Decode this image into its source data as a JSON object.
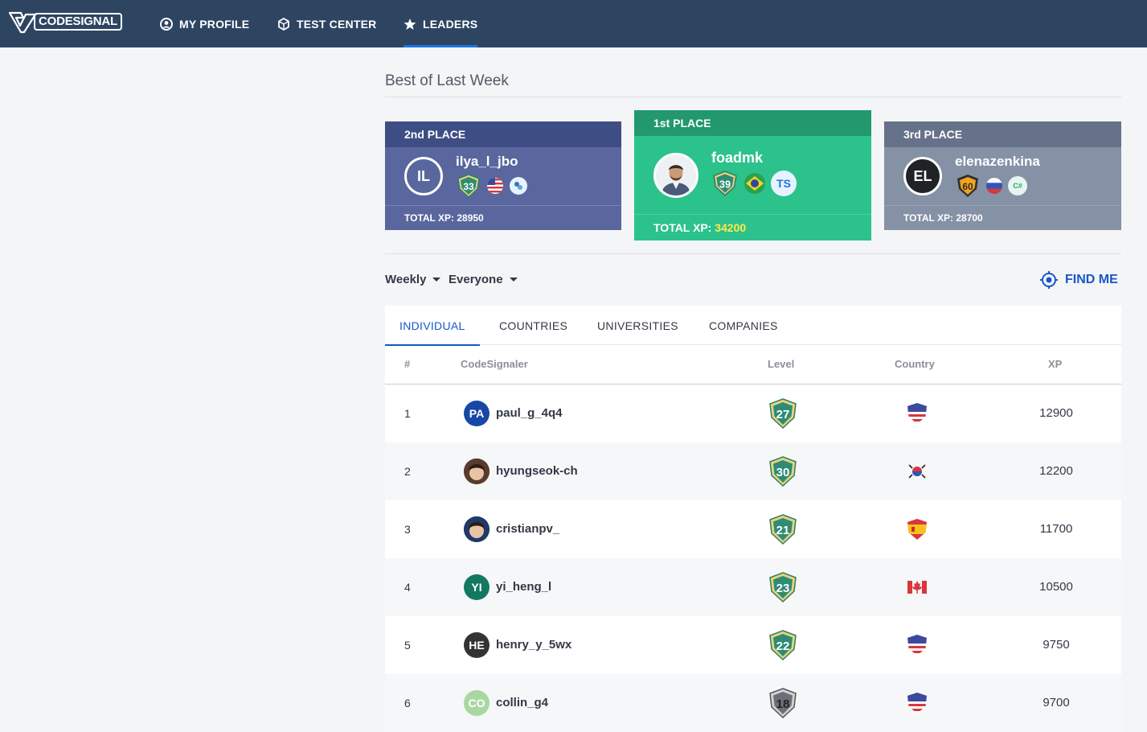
{
  "nav": {
    "logo_text": "CODESIGNAL",
    "items": [
      {
        "label": "MY PROFILE",
        "icon": "user-circle-icon"
      },
      {
        "label": "TEST CENTER",
        "icon": "cube-icon"
      },
      {
        "label": "LEADERS",
        "icon": "star-icon",
        "active": true
      }
    ]
  },
  "section_title": "Best of Last Week",
  "podium": {
    "second": {
      "place": "2nd PLACE",
      "initials": "IL",
      "username": "ilya_l_jbo",
      "level": "33",
      "xp_label": "TOTAL XP:",
      "xp": "28950"
    },
    "first": {
      "place": "1st PLACE",
      "username": "foadmk",
      "level": "39",
      "lang": "TS",
      "xp_label": "TOTAL XP:",
      "xp": "34200"
    },
    "third": {
      "place": "3rd PLACE",
      "initials": "EL",
      "username": "elenazenkina",
      "level": "60",
      "lang": "C#",
      "xp_label": "TOTAL XP:",
      "xp": "28700"
    }
  },
  "filters": {
    "period": "Weekly",
    "scope": "Everyone",
    "find_me": "FIND ME"
  },
  "tabs": [
    "INDIVIDUAL",
    "COUNTRIES",
    "UNIVERSITIES",
    "COMPANIES"
  ],
  "table": {
    "headers": {
      "rank": "#",
      "user": "CodeSignaler",
      "level": "Level",
      "country": "Country",
      "xp": "XP"
    },
    "rows": [
      {
        "rank": "1",
        "initials": "PA",
        "username": "paul_g_4q4",
        "level": "27",
        "country": "us",
        "xp": "12900",
        "avatar_color": "#1748a6"
      },
      {
        "rank": "2",
        "initials": "",
        "username": "hyungseok-ch",
        "level": "30",
        "country": "kr",
        "xp": "12200",
        "avatar_color": "#5a3b2e"
      },
      {
        "rank": "3",
        "initials": "",
        "username": "cristianpv_",
        "level": "21",
        "country": "es",
        "xp": "11700",
        "avatar_color": "#1f3a66"
      },
      {
        "rank": "4",
        "initials": "YI",
        "username": "yi_heng_l",
        "level": "23",
        "country": "ca",
        "xp": "10500",
        "avatar_color": "#137862"
      },
      {
        "rank": "5",
        "initials": "HE",
        "username": "henry_y_5wx",
        "level": "22",
        "country": "us",
        "xp": "9750",
        "avatar_color": "#333333"
      },
      {
        "rank": "6",
        "initials": "CO",
        "username": "collin_g4",
        "level": "18",
        "country": "us",
        "xp": "9700",
        "avatar_color": "#a8d8a0"
      }
    ]
  },
  "colors": {
    "nav_bg": "#2e4562",
    "accent": "#1a56c9",
    "first": "#2cc28c",
    "second": "#59679e",
    "third": "#8591a5",
    "highlight_xp": "#ffe94d"
  }
}
